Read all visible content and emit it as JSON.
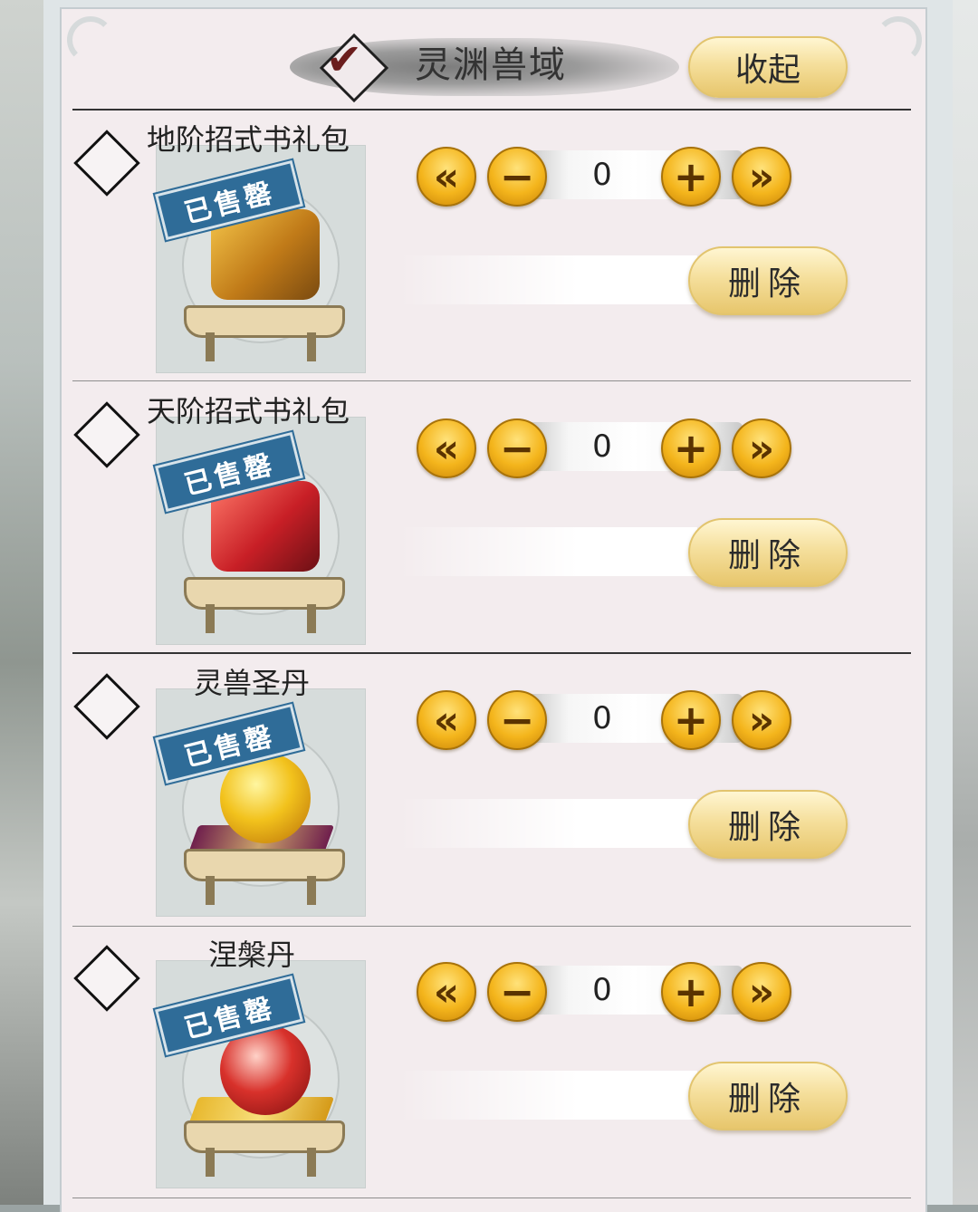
{
  "header": {
    "title": "灵渊兽域",
    "collapse_label": "收起",
    "check_glyph": "✔"
  },
  "item_controls": {
    "first_glyph": "«",
    "minus_glyph": "−",
    "plus_glyph": "+",
    "last_glyph": "»",
    "delete_label": "删除"
  },
  "items": [
    {
      "name": "地阶招式书礼包",
      "badge": "已售罄",
      "quantity": "0",
      "art": "gold-manual-chest"
    },
    {
      "name": "天阶招式书礼包",
      "badge": "已售罄",
      "quantity": "0",
      "art": "red-manual-chest"
    },
    {
      "name": "灵兽圣丹",
      "badge": "已售罄",
      "quantity": "0",
      "art": "golden-dragon-orb"
    },
    {
      "name": "涅槃丹",
      "badge": "已售罄",
      "quantity": "0",
      "art": "red-phoenix-orb"
    }
  ],
  "colors": {
    "panel_bg": "#f3ecee",
    "gold_button": "#f4b51c",
    "stamp_blue": "#2f6c98"
  }
}
